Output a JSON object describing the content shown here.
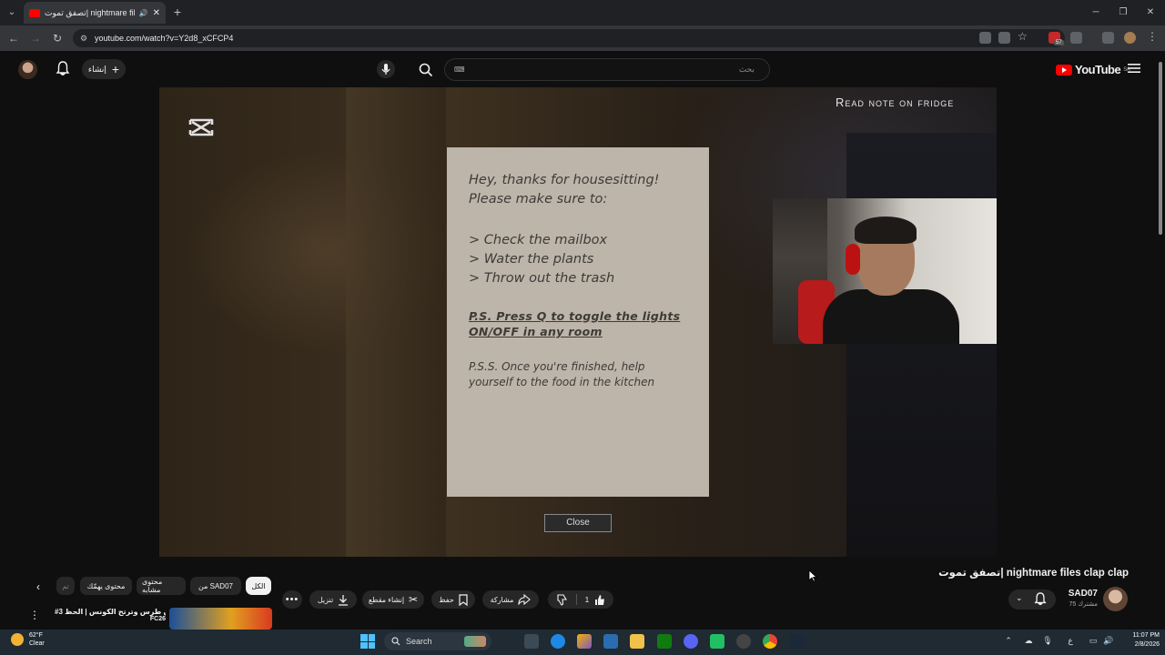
{
  "browser": {
    "tab_title": "تصفق تموت| nightmare files clap clap - YouTube",
    "url": "youtube.com/watch?v=Y2d8_xCFCP4",
    "new_tab": "+"
  },
  "masthead": {
    "create_label": "إنشاء",
    "search_placeholder": "بحث",
    "logo_text": "YouTube",
    "logo_region": "SA",
    "extension_badge": "57"
  },
  "video": {
    "objective": "Read note on fridge",
    "note": {
      "greeting_line1": "Hey, thanks for housesitting!",
      "greeting_line2": "Please make sure to:",
      "tasks": [
        "> Check the mailbox",
        "> Water the plants",
        "> Throw out the trash"
      ],
      "ps_line1": "P.S. Press Q to toggle the lights",
      "ps_line2": "ON/OFF in any room",
      "pss_line1": "P.S.S. Once you're finished, help",
      "pss_line2": "yourself to the food in the kitchen"
    },
    "close_label": "Close"
  },
  "watch": {
    "title": "تصفق تموت| nightmare files clap clap",
    "channel_name": "SAD07",
    "subscribers": "75 مشترك",
    "like_count": "1",
    "share_label": "مشاركة",
    "save_label": "حفظ",
    "clip_label": "إنشاء مقطع",
    "download_label": "تنزيل"
  },
  "chips": [
    "الكل",
    "من SAD07",
    "محتوى مشابه",
    "محتوى يهمّك",
    "تم"
  ],
  "related": {
    "title": "#3 بدون طرس وترتح الكونس | الحظ",
    "subtitle": "FC26"
  },
  "taskbar": {
    "temperature": "62°F",
    "weather": "Clear",
    "search_label": "Search",
    "time": "11:07 PM",
    "date": "2/8/2026",
    "lang": "ع"
  },
  "colors": {
    "accent": "#ff0000",
    "background": "#0f0f0f",
    "note_paper": "#bdb5aa"
  }
}
